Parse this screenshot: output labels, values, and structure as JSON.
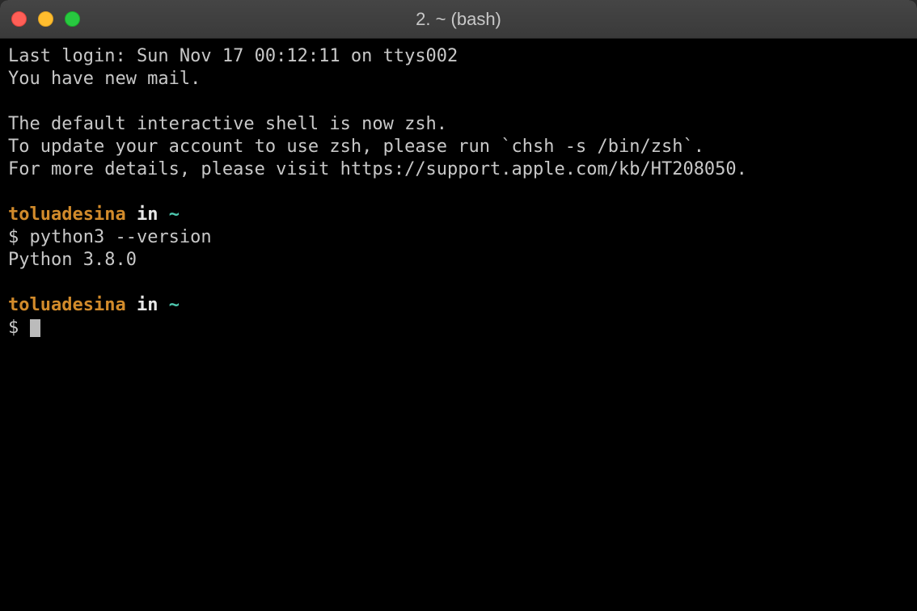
{
  "titlebar": {
    "title": "2. ~ (bash)"
  },
  "terminal": {
    "line1": "Last login: Sun Nov 17 00:12:11 on ttys002",
    "line2": "You have new mail.",
    "line3": "",
    "line4": "The default interactive shell is now zsh.",
    "line5": "To update your account to use zsh, please run `chsh -s /bin/zsh`.",
    "line6": "For more details, please visit https://support.apple.com/kb/HT208050.",
    "line7": "",
    "prompt1": {
      "username": "toluadesina",
      "inword": " in ",
      "tilde": "~"
    },
    "command1_prefix": "$ ",
    "command1": "python3 --version",
    "output1": "Python 3.8.0",
    "blank2": "",
    "prompt2": {
      "username": "toluadesina",
      "inword": " in ",
      "tilde": "~"
    },
    "command2_prefix": "$ "
  }
}
